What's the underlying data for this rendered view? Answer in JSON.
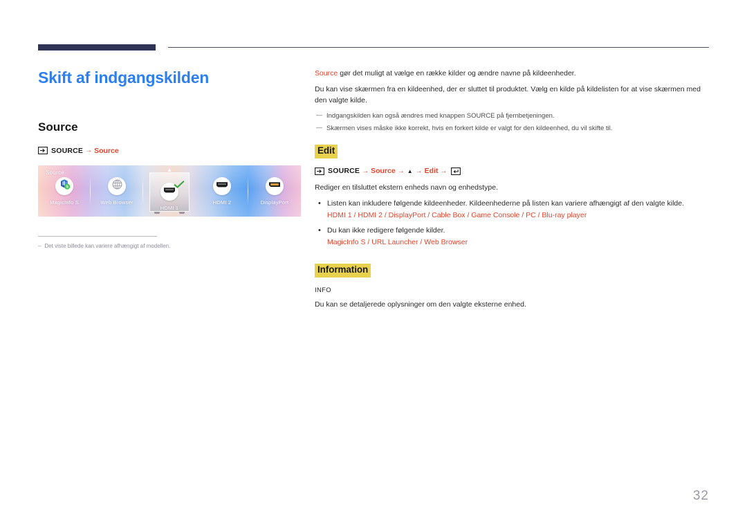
{
  "page": {
    "number": "32"
  },
  "left": {
    "title": "Skift af indgangskilden",
    "section_heading": "Source",
    "nav": {
      "source_icon": "source-input-icon",
      "button_label": "SOURCE",
      "arrow": "→",
      "target": "Source"
    },
    "figure": {
      "overlay_label": "Source",
      "chevron_icon": "chevron-up-icon",
      "check_icon": "check-icon",
      "items": [
        {
          "name": "MagicInfo S",
          "icon": "magicinfo-cube-icon",
          "selected": false
        },
        {
          "name": "Web Browser",
          "icon": "globe-icon",
          "selected": false
        },
        {
          "name": "HDMI 1",
          "icon": "hdmi-port-icon",
          "selected": true
        },
        {
          "name": "HDMI 2",
          "icon": "hdmi-port-icon",
          "selected": false
        },
        {
          "name": "DisplayPort",
          "icon": "displayport-port-icon",
          "selected": false
        }
      ]
    },
    "footnote": {
      "dash": "–",
      "text": "Det viste billede kan variere afhængigt af modellen."
    }
  },
  "right": {
    "intro": {
      "lead_red": "Source",
      "lead_rest": " gør det muligt at vælge en række kilder og ændre navne på kildeenheder.",
      "paragraph": "Du kan vise skærmen fra en kildeenhed, der er sluttet til produktet. Vælg en kilde på kildelisten for at vise skærmen med den valgte kilde."
    },
    "notes": [
      "Indgangskilden kan også ændres med knappen SOURCE på fjernbetjeningen.",
      "Skærmen vises måske ikke korrekt, hvis en forkert kilde er valgt for den kildeenhed, du vil skifte til."
    ],
    "note_dash": "—",
    "edit": {
      "heading": "Edit",
      "nav": {
        "source_icon": "source-input-icon",
        "button_label": "SOURCE",
        "arrow": "→",
        "step1": "Source",
        "triangle": "▲",
        "step2": "Edit",
        "enter_icon": "enter-key-icon"
      },
      "description": "Rediger en tilsluttet ekstern enheds navn og enhedstype.",
      "bullets": [
        {
          "text": "Listen kan inkludere følgende kildeenheder. Kildeenhederne på listen kan variere afhængigt af den valgte kilde.",
          "red_list": "HDMI 1 / HDMI 2 / DisplayPort / Cable Box / Game Console / PC / Blu-ray player"
        },
        {
          "text": "Du kan ikke redigere følgende kilder.",
          "red_list": "MagicInfo S / URL Launcher / Web Browser"
        }
      ]
    },
    "information": {
      "heading": "Information",
      "label": "INFO",
      "description": "Du kan se detaljerede oplysninger om den valgte eksterne enhed."
    }
  },
  "colors": {
    "title_blue": "#2d7ff0",
    "accent_red": "#e8432a",
    "highlight_yellow": "#e8d14d",
    "rule_navy": "#2f3356"
  }
}
